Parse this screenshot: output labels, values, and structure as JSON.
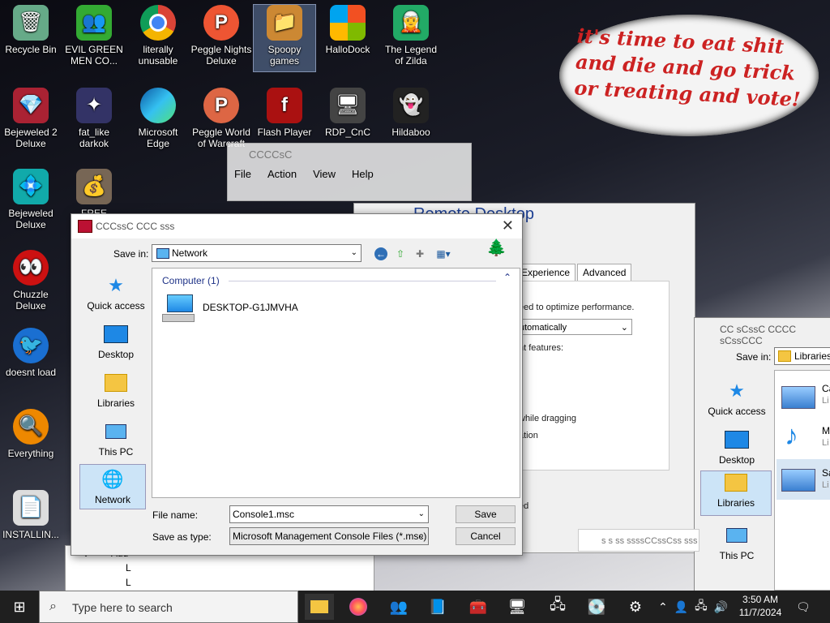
{
  "desktop_icons": [
    {
      "label": "Recycle Bin",
      "icon": "recycle-bin-icon"
    },
    {
      "label": "EVIL GREEN MEN CO...",
      "icon": "green-men-icon"
    },
    {
      "label": "literally unusable",
      "icon": "chrome-icon"
    },
    {
      "label": "Peggle Nights Deluxe",
      "icon": "peggle-icon"
    },
    {
      "label": "Spoopy games",
      "icon": "folder-icon"
    },
    {
      "label": "HalloDock",
      "icon": "windows-logo-icon"
    },
    {
      "label": "The Legend of Zilda",
      "icon": "zelda-icon"
    },
    {
      "label": "Bejeweled 2 Deluxe",
      "icon": "bejeweled2-icon"
    },
    {
      "label": "fat_like darkok",
      "icon": "app-icon"
    },
    {
      "label": "Microsoft Edge",
      "icon": "edge-icon"
    },
    {
      "label": "Peggle World of Warcraft",
      "icon": "peggle-wow-icon"
    },
    {
      "label": "Flash Player",
      "icon": "flash-icon"
    },
    {
      "label": "RDP_CnC",
      "icon": "rdp-icon"
    },
    {
      "label": "Hildaboo",
      "icon": "hildaboo-icon"
    },
    {
      "label": "Bejeweled Deluxe",
      "icon": "bejeweled-icon"
    },
    {
      "label": "FREE",
      "icon": "money-bag-icon"
    },
    {
      "label": "Chuzzle Deluxe",
      "icon": "chuzzle-icon"
    },
    {
      "label": "doesnt load",
      "icon": "thunderbird-icon"
    },
    {
      "label": "Everything",
      "icon": "everything-icon"
    },
    {
      "label": "INSTALLIN...",
      "icon": "installer-icon"
    }
  ],
  "meme_text": "it's time to eat shit and die and go trick or treating and vote!",
  "ghost_window": {
    "title": "CCCCsC",
    "menu": [
      "File",
      "Action",
      "View",
      "Help"
    ]
  },
  "rdp": {
    "title": "Remote Desktop",
    "tabs": [
      "Experience",
      "Advanced"
    ],
    "text1": "eed to optimize performance.",
    "select": "utomatically",
    "text2": "nt features:",
    "text3": "while dragging",
    "text4": "ation",
    "text5": "ed"
  },
  "save_dialog": {
    "title": "CCCssC CCC sss",
    "save_in_label": "Save in:",
    "save_in_value": "Network",
    "places": [
      "Quick access",
      "Desktop",
      "Libraries",
      "This PC",
      "Network"
    ],
    "group_header": "Computer (1)",
    "item": "DESKTOP-G1JMVHA",
    "file_name_label": "File name:",
    "file_name": "Console1.msc",
    "save_type_label": "Save as type:",
    "save_type": "Microsoft Management Console Files (*.msc)",
    "save_button": "Save",
    "cancel_button": "Cancel"
  },
  "save_dialog2": {
    "title": "CC sCssC CCCC sCssCCC",
    "save_in_label": "Save in:",
    "save_in_value": "Libraries",
    "places": [
      "Quick access",
      "Desktop",
      "Libraries",
      "This PC"
    ],
    "items": [
      "Ca",
      "M",
      "Sa"
    ],
    "sub": "Li"
  },
  "small_box": "s s  ss ssssCCssCss sss",
  "tree": {
    "item": "Aud",
    "sub1": "L",
    "sub2": "L"
  },
  "taskbar": {
    "search_placeholder": "Type here to search",
    "time": "3:50 AM",
    "date": "11/7/2024"
  }
}
